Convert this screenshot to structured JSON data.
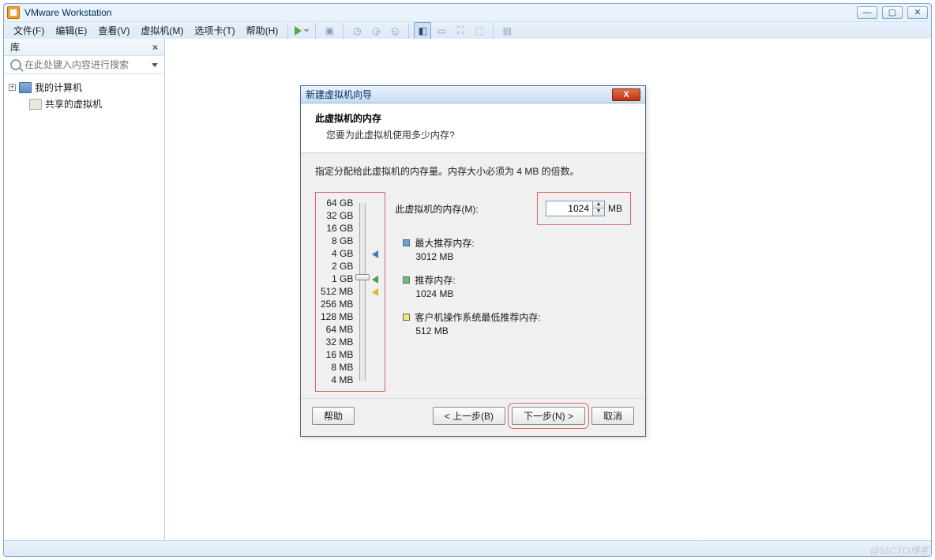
{
  "app": {
    "title": "VMware Workstation"
  },
  "menubar": {
    "file": "文件(F)",
    "edit": "编辑(E)",
    "view": "查看(V)",
    "vm": "虚拟机(M)",
    "tabs": "选项卡(T)",
    "help": "帮助(H)"
  },
  "sidebar": {
    "title": "库",
    "search_placeholder": "在此处键入内容进行搜索",
    "items": [
      {
        "label": "我的计算机"
      },
      {
        "label": "共享的虚拟机"
      }
    ]
  },
  "dialog": {
    "title": "新建虚拟机向导",
    "heading": "此虚拟机的内存",
    "sub": "您要为此虚拟机使用多少内存?",
    "desc": "指定分配给此虚拟机的内存量。内存大小必须为 4 MB 的倍数。",
    "field_label": "此虚拟机的内存(M):",
    "value": "1024",
    "unit": "MB",
    "scale": [
      "64 GB",
      "32 GB",
      "16 GB",
      "8 GB",
      "4 GB",
      "2 GB",
      "1 GB",
      "512 MB",
      "256 MB",
      "128 MB",
      "64 MB",
      "32 MB",
      "16 MB",
      "8 MB",
      "4 MB"
    ],
    "rec_max_label": "最大推荐内存:",
    "rec_max_val": "3012 MB",
    "rec_label": "推荐内存:",
    "rec_val": "1024 MB",
    "rec_min_label": "客户机操作系统最低推荐内存:",
    "rec_min_val": "512 MB",
    "buttons": {
      "help": "帮助",
      "back": "< 上一步(B)",
      "next": "下一步(N) >",
      "cancel": "取消"
    }
  },
  "watermark": "@51CTO博客"
}
